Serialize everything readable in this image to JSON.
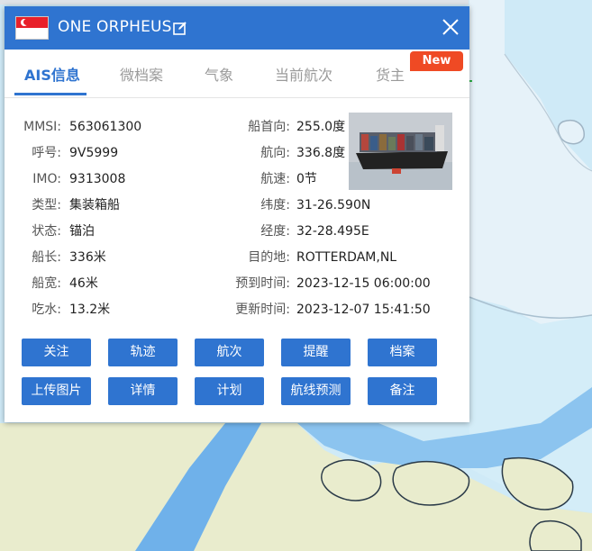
{
  "panel": {
    "ship_name": "ONE ORPHEUS",
    "flag_icon": "singapore-flag-icon"
  },
  "tabs": [
    {
      "label": "AIS信息",
      "active": true
    },
    {
      "label": "微档案",
      "active": false
    },
    {
      "label": "气象",
      "active": false
    },
    {
      "label": "当前航次",
      "active": false
    },
    {
      "label": "货主",
      "active": false
    }
  ],
  "badge": {
    "label": "New"
  },
  "left_fields": [
    {
      "label": "MMSI:",
      "value": "563061300"
    },
    {
      "label": "呼号:",
      "value": "9V5999"
    },
    {
      "label": "IMO:",
      "value": "9313008"
    },
    {
      "label": "类型:",
      "value": "集装箱船"
    },
    {
      "label": "状态:",
      "value": "锚泊"
    },
    {
      "label": "船长:",
      "value": "336米"
    },
    {
      "label": "船宽:",
      "value": "46米"
    },
    {
      "label": "吃水:",
      "value": "13.2米"
    }
  ],
  "right_fields": [
    {
      "label": "船首向:",
      "value": "255.0度"
    },
    {
      "label": "航向:",
      "value": "336.8度"
    },
    {
      "label": "航速:",
      "value": "0节"
    },
    {
      "label": "纬度:",
      "value": "31-26.590N"
    },
    {
      "label": "经度:",
      "value": "32-28.495E"
    },
    {
      "label": "目的地:",
      "value": "ROTTERDAM,NL"
    },
    {
      "label": "预到时间:",
      "value": "2023-12-15 06:00:00"
    },
    {
      "label": "更新时间:",
      "value": "2023-12-07 15:41:50"
    }
  ],
  "buttons_row1": [
    "关注",
    "轨迹",
    "航次",
    "提醒",
    "档案"
  ],
  "buttons_row2": [
    "上传图片",
    "详情",
    "计划",
    "航线预测",
    "备注"
  ],
  "colors": {
    "primary": "#2f74d0",
    "badge": "#ef4a24",
    "land": "#e9eccd",
    "water": "#cfeaf7",
    "channel": "#6fb1ea"
  }
}
